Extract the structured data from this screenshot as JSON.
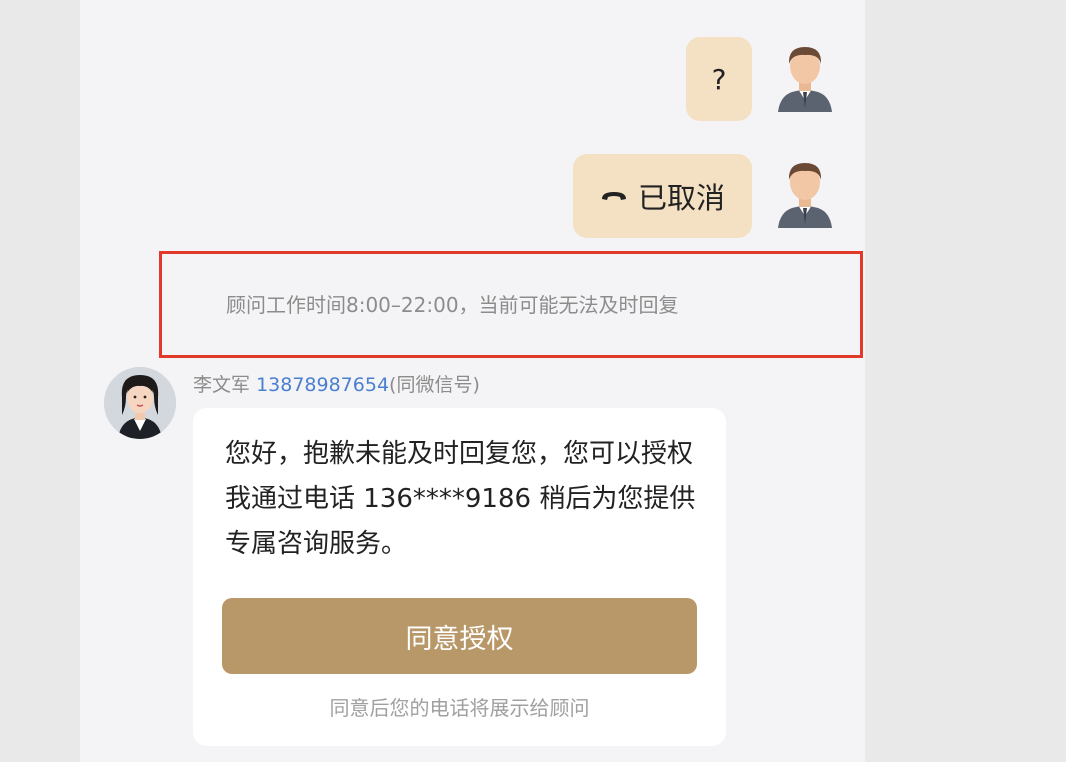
{
  "messages": {
    "question_text": "?",
    "call_status_text": "已取消"
  },
  "icons": {
    "call_icon": "hang-up-phone-icon",
    "user_avatar": "male-user-avatar",
    "agent_avatar": "female-agent-avatar"
  },
  "notice": {
    "text": "顾问工作时间8:00–22:00，当前可能无法及时回复"
  },
  "agent": {
    "name": "李文军",
    "phone": "13878987654",
    "phone_note": "(同微信号)"
  },
  "card": {
    "text": "您好，抱歉未能及时回复您，您可以授权我通过电话 136****9186 稍后为您提供专属咨询服务。",
    "button_label": "同意授权",
    "footnote": "同意后您的电话将展示给顾问"
  },
  "colors": {
    "bubble": "#f4e0c3",
    "accent_button": "#b89868",
    "highlight_border": "#e23a2a",
    "phone_link": "#4a7fd0"
  }
}
